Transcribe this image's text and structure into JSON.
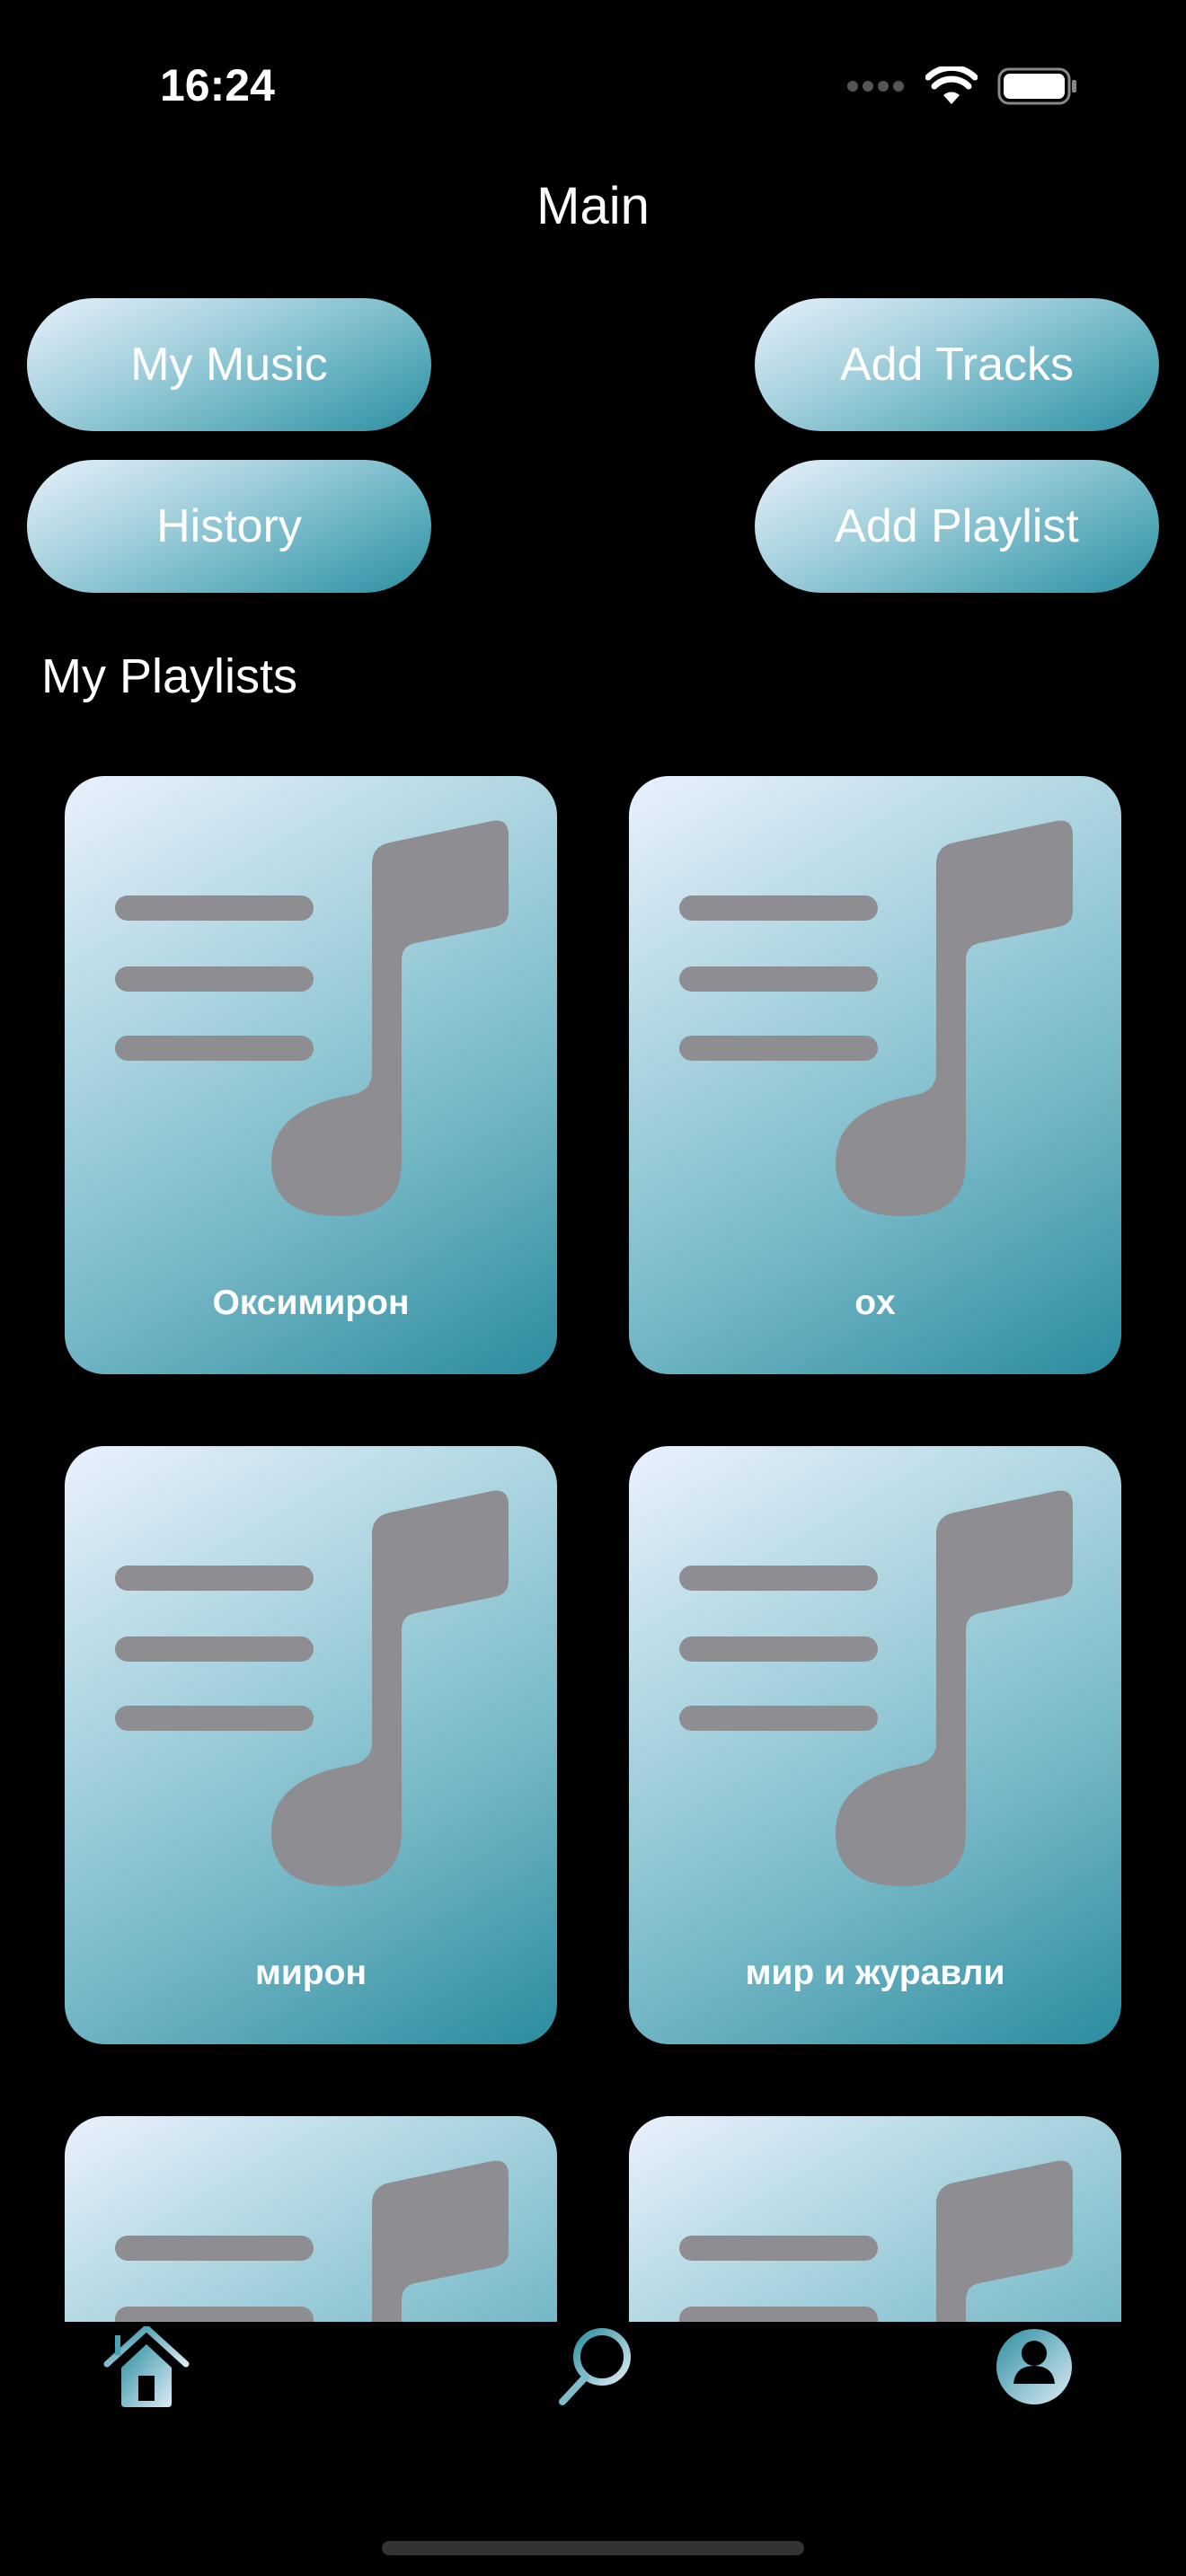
{
  "status_bar": {
    "time": "16:24"
  },
  "header": {
    "title": "Main"
  },
  "buttons": {
    "my_music": "My Music",
    "add_tracks": "Add Tracks",
    "history": "History",
    "add_playlist": "Add Playlist"
  },
  "section_title": "My Playlists",
  "playlists": [
    {
      "name": "Оксимирон"
    },
    {
      "name": "ox"
    },
    {
      "name": "мирон"
    },
    {
      "name": "мир и журавли"
    },
    {
      "name": ""
    },
    {
      "name": ""
    }
  ],
  "tab_bar": {
    "items": [
      {
        "icon": "home-icon",
        "active": true
      },
      {
        "icon": "search-icon"
      },
      {
        "icon": "profile-icon"
      }
    ]
  },
  "colors": {
    "gradient_start": "#eaf1fd",
    "gradient_end": "#2b8c9e",
    "icon_gray": "#8e8d92"
  }
}
